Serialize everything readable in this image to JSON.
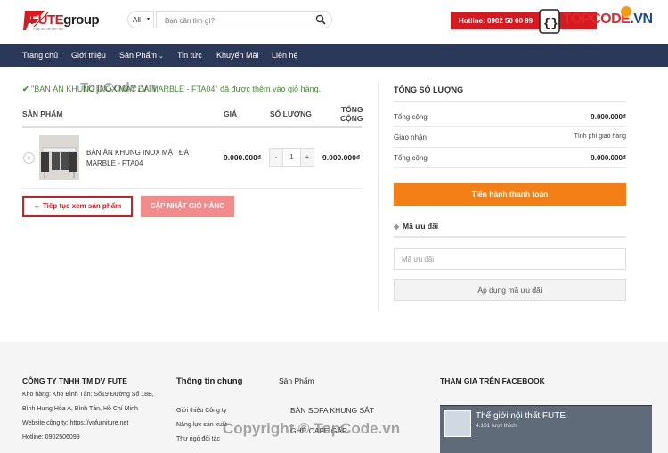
{
  "header": {
    "logo_brand": "FUTE",
    "logo_group": "group",
    "logo_slogan": "Thay đổi để tiến lên",
    "category_select": "All",
    "search_placeholder": "Bạn cần tìm gì?",
    "hotline": "Hotline: 0902 50 60 99",
    "watermark_brand": "TOPCODE",
    "watermark_tld": ".VN"
  },
  "nav": {
    "items": [
      "Trang chủ",
      "Giới thiệu",
      "Sản Phẩm",
      "Tin tức",
      "Khuyến Mãi",
      "Liên hệ"
    ]
  },
  "cart": {
    "notice": "\"BÀN ĂN KHUNG INOX MẶT ĐÁ MARBLE - FTA04\" đã được thêm vào giỏ hàng.",
    "watermark": "TopCode.vn",
    "columns": {
      "product": "SẢN PHẨM",
      "price": "GIÁ",
      "quantity": "SỐ LƯỢNG",
      "total_line1": "TỔNG",
      "total_line2": "CỘNG"
    },
    "item": {
      "name": "BÀN ĂN KHUNG INOX MẶT ĐÁ MARBLE - FTA04",
      "price": "9.000.000₫",
      "qty": "1",
      "subtotal": "9.000.000₫"
    },
    "continue_label": "← Tiếp tục xem sản phẩm",
    "update_label": "CẬP NHẬT GIỎ HÀNG"
  },
  "summary": {
    "title": "TỔNG SỐ LƯỢNG",
    "rows": [
      {
        "label": "Tổng cộng",
        "value": "9.000.000₫"
      },
      {
        "label": "Giao nhận",
        "value": "Tính phí giao hàng"
      },
      {
        "label": "Tổng cộng",
        "value": "9.000.000₫"
      }
    ],
    "checkout_label": "Tiến hành thanh toán",
    "coupon_title": "Mã ưu đãi",
    "coupon_placeholder": "Mã ưu đãi",
    "coupon_button": "Áp dụng mã ưu đãi"
  },
  "footer": {
    "company": "CÔNG TY TNHH TM DV FUTE",
    "address1": "Kho hàng: Kho Bình Tân: Số19 Đường Số 18B,",
    "address2": "Bình Hưng Hòa A, Bình Tân, Hồ Chí Minh",
    "website": "Website công ty: https://vnfurniture.net",
    "hotline": "Hotline: 0902506099",
    "info_title": "Thông tin chung",
    "info_links": [
      "Giới thiệu Công ty",
      "Năng lực sản xuất",
      "Thư ngỏ đối tác"
    ],
    "product_title": "Sản Phẩm",
    "product_links": [
      "BÀN SOFA KHUNG SẮT",
      "GHẾ CAFE GẤP"
    ],
    "fb_title": "THAM GIA TRÊN FACEBOOK",
    "fb_page": "Thế giới nội thất FUTE",
    "fb_likes": "4.151 lượt thích",
    "copyright": "Copyright © TopCode.vn"
  }
}
